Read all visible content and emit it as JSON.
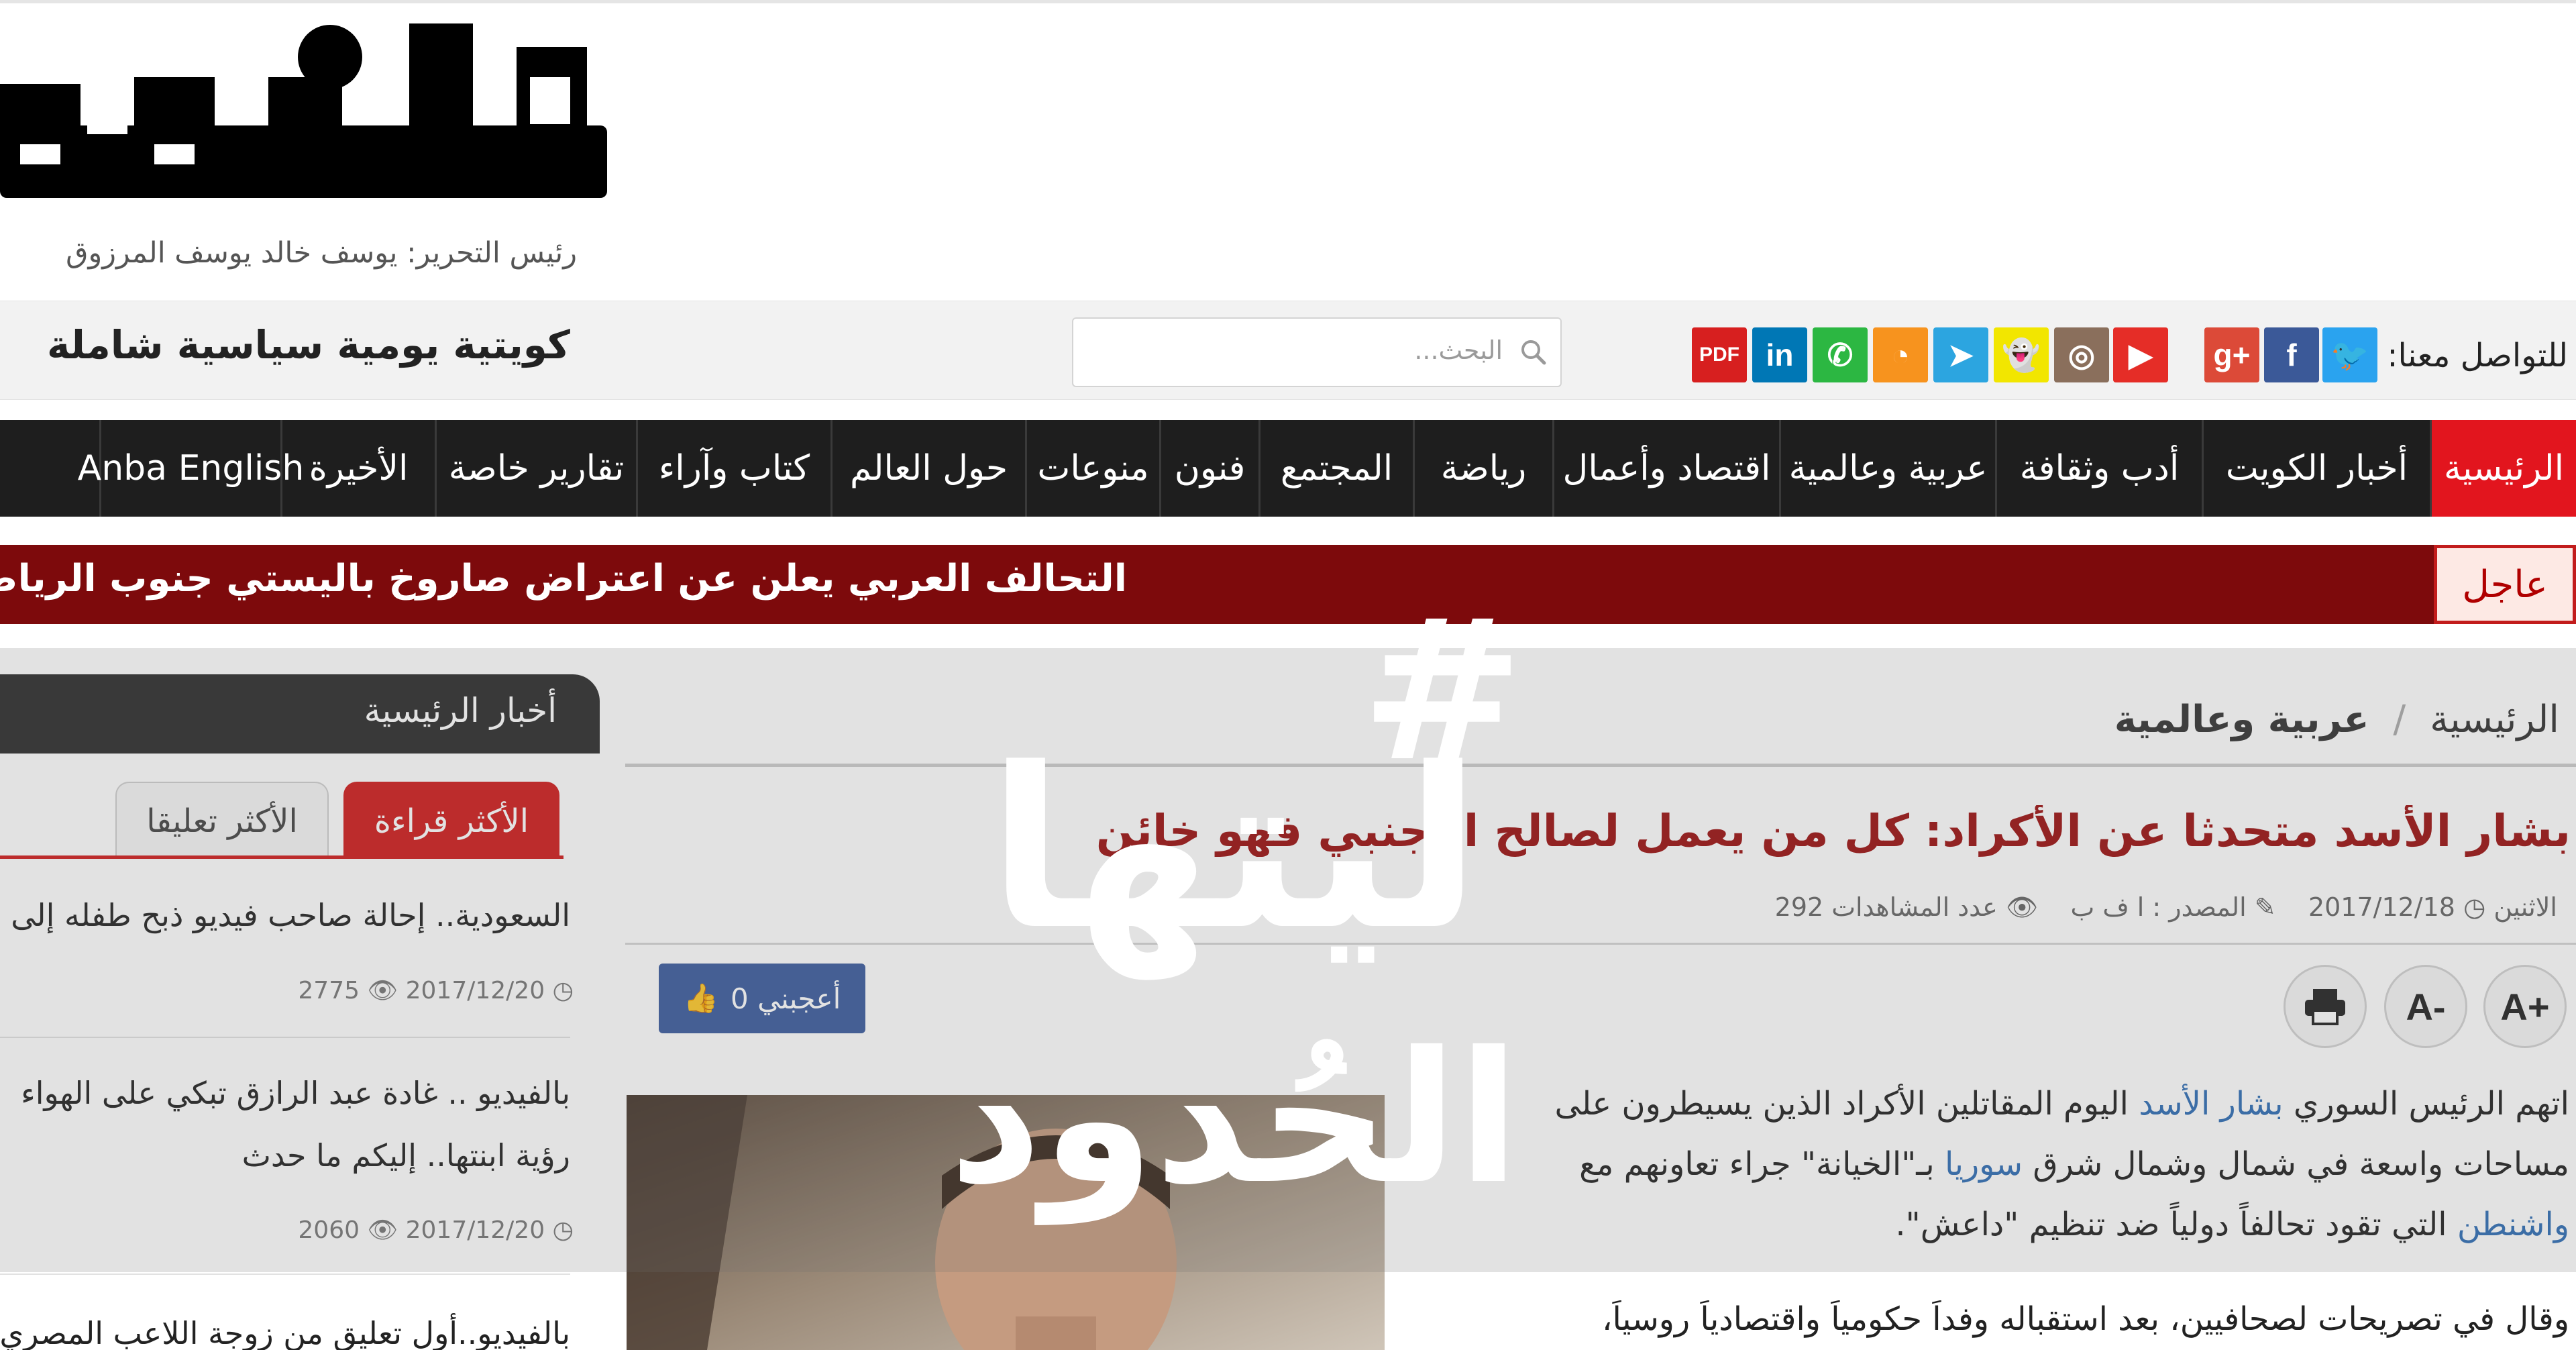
{
  "header": {
    "logo_text": "الأنباء",
    "editor_line": "رئيس التحرير: يوسف خالد يوسف المرزوق",
    "tagline": "كويتية يومية سياسية شاملة",
    "search_placeholder": "البحث...",
    "contact_label": "للتواصل معنا:",
    "social": [
      {
        "name": "twitter",
        "glyph": "🐦",
        "color": "#2aa3ef"
      },
      {
        "name": "facebook",
        "glyph": "f",
        "color": "#3b5998"
      },
      {
        "name": "google-plus",
        "glyph": "g+",
        "color": "#dc4a38"
      },
      {
        "name": "youtube",
        "glyph": "▶",
        "color": "#e52d27"
      },
      {
        "name": "instagram",
        "glyph": "◎",
        "color": "#8a6f5c"
      },
      {
        "name": "snapchat",
        "glyph": "👻",
        "color": "#f2e600"
      },
      {
        "name": "telegram",
        "glyph": "➤",
        "color": "#2ca5e0"
      },
      {
        "name": "rss",
        "glyph": "◔",
        "color": "#f7931e"
      },
      {
        "name": "whatsapp",
        "glyph": "✆",
        "color": "#2cb742"
      },
      {
        "name": "linkedin",
        "glyph": "in",
        "color": "#0077b5"
      },
      {
        "name": "pdf",
        "glyph": "PDF",
        "color": "#d71f1f"
      }
    ]
  },
  "nav": {
    "items": [
      {
        "label": "الرئيسية",
        "active": true
      },
      {
        "label": "أخبار الكويت"
      },
      {
        "label": "أدب وثقافة"
      },
      {
        "label": "عربية وعالمية"
      },
      {
        "label": "اقتصاد وأعمال"
      },
      {
        "label": "رياضة"
      },
      {
        "label": "المجتمع"
      },
      {
        "label": "فنون"
      },
      {
        "label": "منوعات"
      },
      {
        "label": "حول العالم"
      },
      {
        "label": "كتاب وآراء"
      },
      {
        "label": "تقارير خاصة"
      },
      {
        "label": "الأخيرة"
      },
      {
        "label": "Anba English"
      }
    ]
  },
  "breaking": {
    "label": "عاجل",
    "text": "التحالف العربي يعلن عن اعتراض صاروخ باليستي جنوب الرياض.."
  },
  "sidebar": {
    "heading": "أخبار الرئيسية",
    "tabs": [
      {
        "label": "الأكثر قراءة",
        "active": true
      },
      {
        "label": "الأكثر تعليقا"
      }
    ],
    "items": [
      {
        "title": "السعودية.. إحالة صاحب فيديو ذبح طفله إلى",
        "date": "2017/12/20",
        "views": "2775"
      },
      {
        "title": "بالفيديو .. غادة عبد الرازق تبكي على الهواء",
        "title2": "رؤية ابنتها.. إليكم ما حدث",
        "date": "2017/12/20",
        "views": "2060"
      },
      {
        "title": "بالفيديو..أول تعليق من زوجة اللاعب المصري"
      }
    ]
  },
  "article": {
    "breadcrumb_home": "الرئيسية",
    "breadcrumb_sep": "/",
    "breadcrumb_section": "عربية وعالمية",
    "title": "بشار الأسد متحدثا عن الأكراد: كل من يعمل لصالح الأجنبي فهو خائن",
    "day": "الاثنين",
    "date": "2017/12/18",
    "source": "المصدر : ا ف ب",
    "views_label": "عدد المشاهدات",
    "views": "292",
    "like_label": "أعجبني 0",
    "tools": {
      "increase": "A+",
      "decrease": "A-"
    },
    "para1": {
      "t1": "اتهم الرئيس السوري",
      "link1": "بشار الأسد",
      "t2": "اليوم المقاتلين الأكراد الذين يسيطرون على مساحات واسعة في شمال وشمال شرق",
      "link2": "سوريا",
      "t3": "بـ\"الخيانة\" جراء تعاونهم مع",
      "link3": "واشنطن",
      "t4": "التي تقود تحالفاً دولياً ضد تنظيم \"داعش\"."
    },
    "para2": "وقال في تصريحات لصحافيين، بعد استقباله وفداً حكومياً واقتصادياً روسياً،"
  },
  "watermark": {
    "hashtag": "#",
    "line1": "ليتها",
    "line2": "الحُدود"
  }
}
